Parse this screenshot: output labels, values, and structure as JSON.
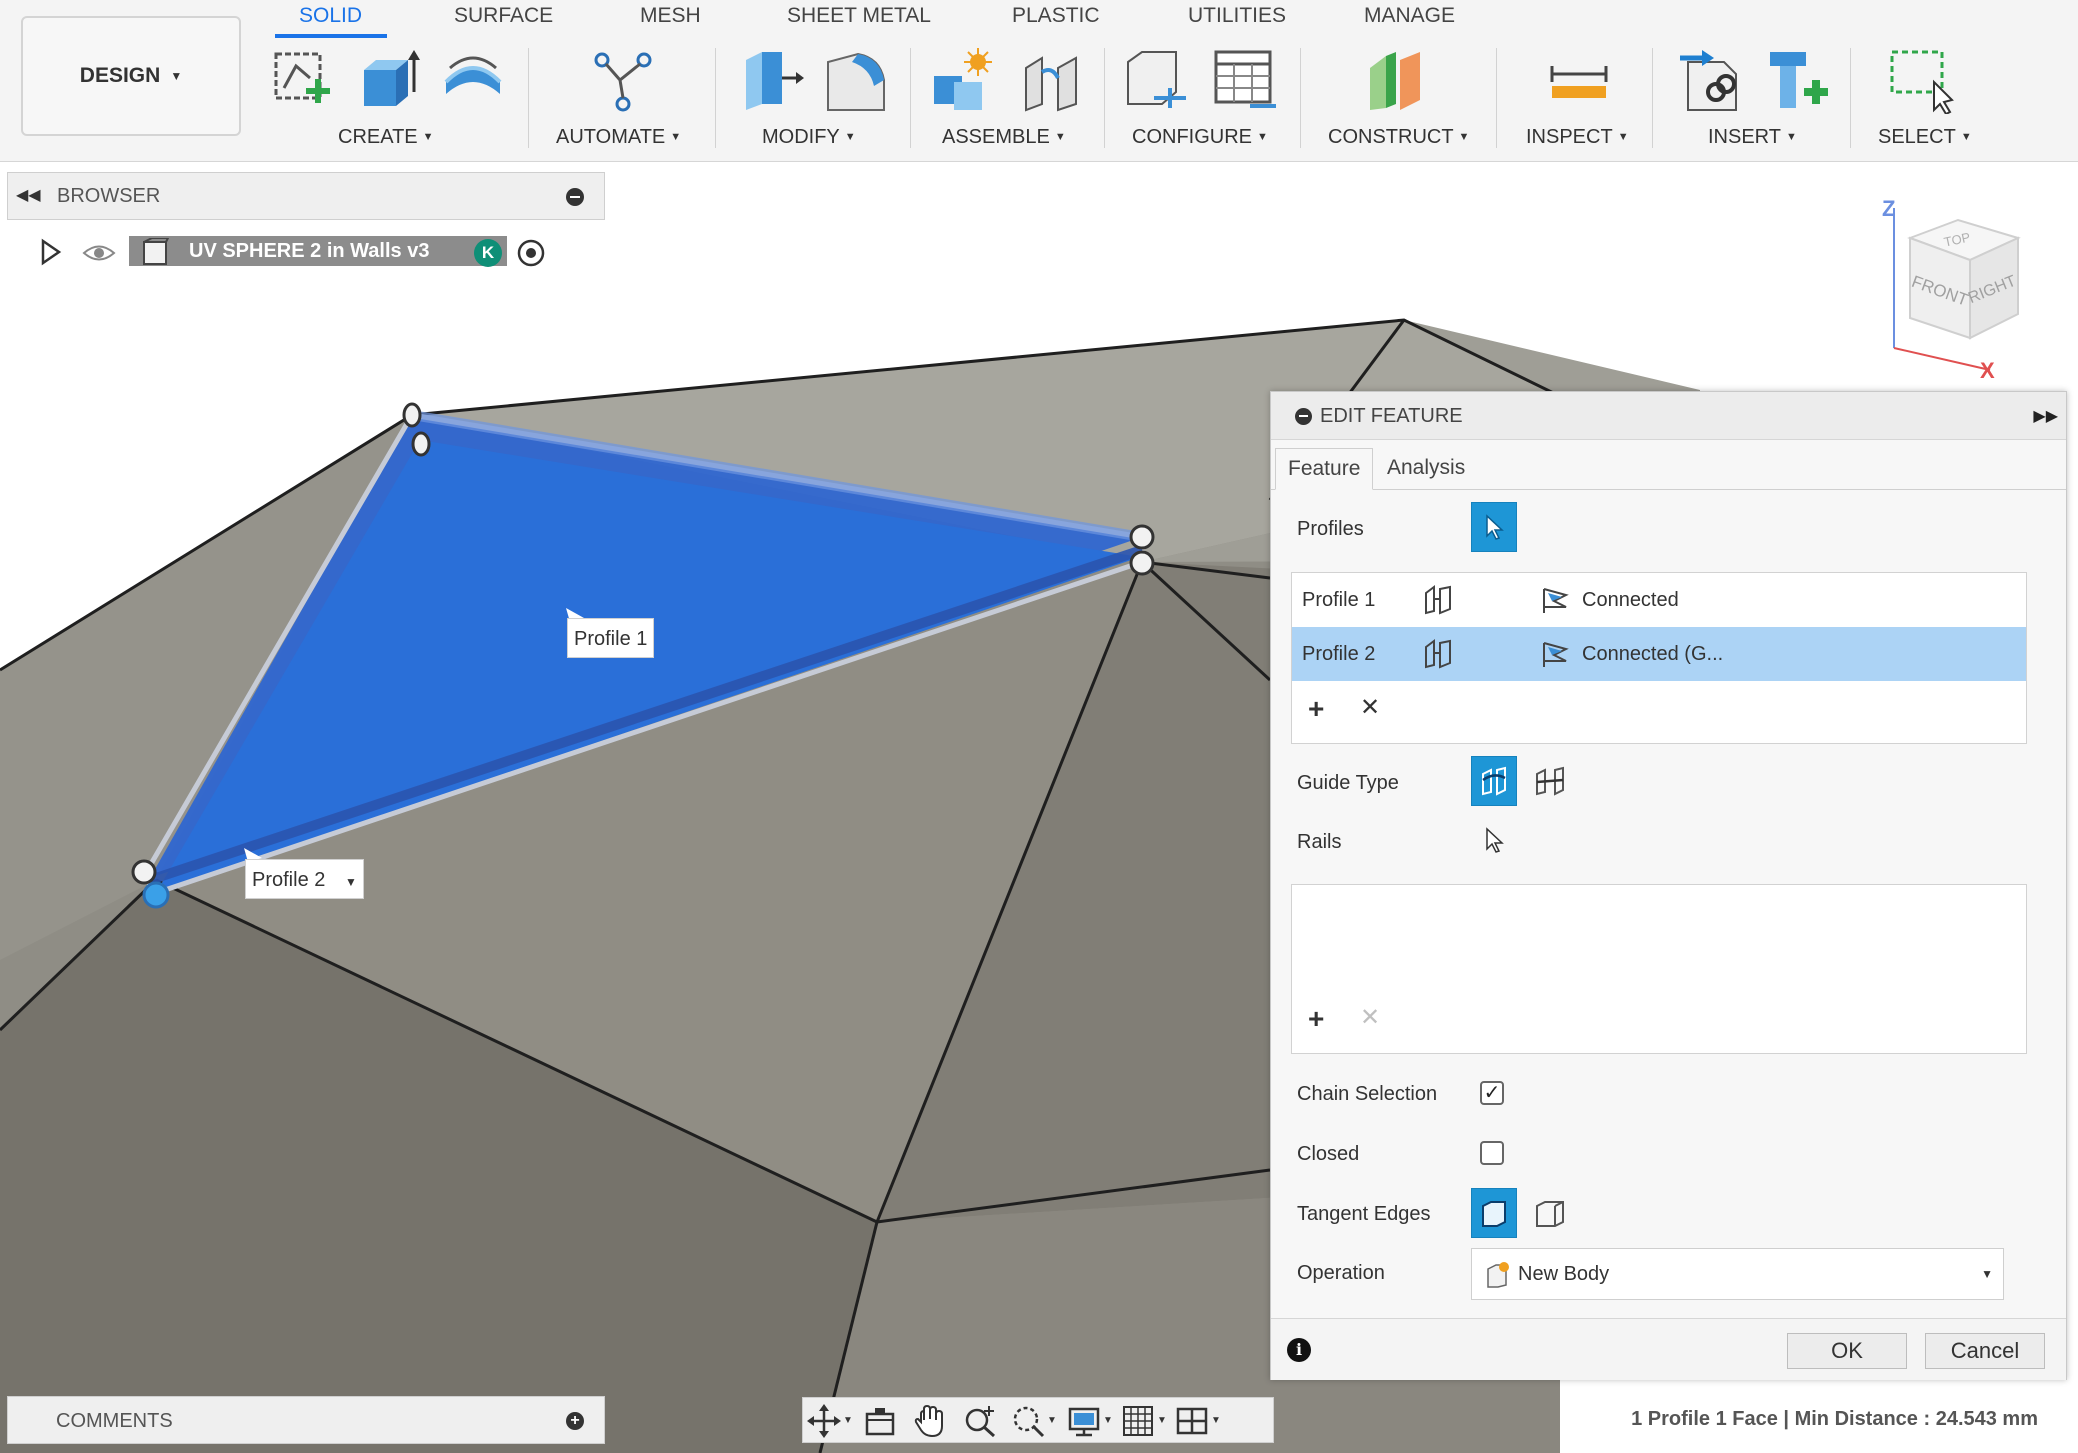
{
  "workspace": {
    "label": "DESIGN"
  },
  "tabs": [
    "SOLID",
    "SURFACE",
    "MESH",
    "SHEET METAL",
    "PLASTIC",
    "UTILITIES",
    "MANAGE"
  ],
  "active_tab": "SOLID",
  "groups": [
    "CREATE",
    "AUTOMATE",
    "MODIFY",
    "ASSEMBLE",
    "CONFIGURE",
    "CONSTRUCT",
    "INSPECT",
    "INSERT",
    "SELECT"
  ],
  "browser": {
    "title": "BROWSER",
    "document": "UV SPHERE 2 in Walls v3",
    "badge": "K"
  },
  "viewport": {
    "profile_tags": [
      "Profile 1",
      "Profile 2"
    ],
    "viewcube": {
      "top": "TOP",
      "front": "FRONT",
      "right": "RIGHT",
      "axis_z": "Z",
      "axis_x": "X"
    }
  },
  "dialog": {
    "title": "EDIT FEATURE",
    "tabs": [
      "Feature",
      "Analysis"
    ],
    "active_tab": "Feature",
    "profiles_label": "Profiles",
    "profiles": [
      {
        "name": "Profile 1",
        "condition": "Connected",
        "selected": false
      },
      {
        "name": "Profile 2",
        "condition": "Connected (G...",
        "selected": true
      }
    ],
    "guide_type_label": "Guide Type",
    "rails_label": "Rails",
    "chain_selection_label": "Chain Selection",
    "chain_selection": true,
    "closed_label": "Closed",
    "closed": false,
    "tangent_edges_label": "Tangent Edges",
    "operation_label": "Operation",
    "operation_value": "New Body",
    "ok_label": "OK",
    "cancel_label": "Cancel"
  },
  "comments": {
    "title": "COMMENTS"
  },
  "status": "1 Profile 1 Face | Min Distance : 24.543 mm",
  "colors": {
    "accent": "#1a73e8",
    "selection_blue": "#2a6fd8",
    "highlight_row": "#acd3f5",
    "button_blue": "#1e96d6"
  }
}
